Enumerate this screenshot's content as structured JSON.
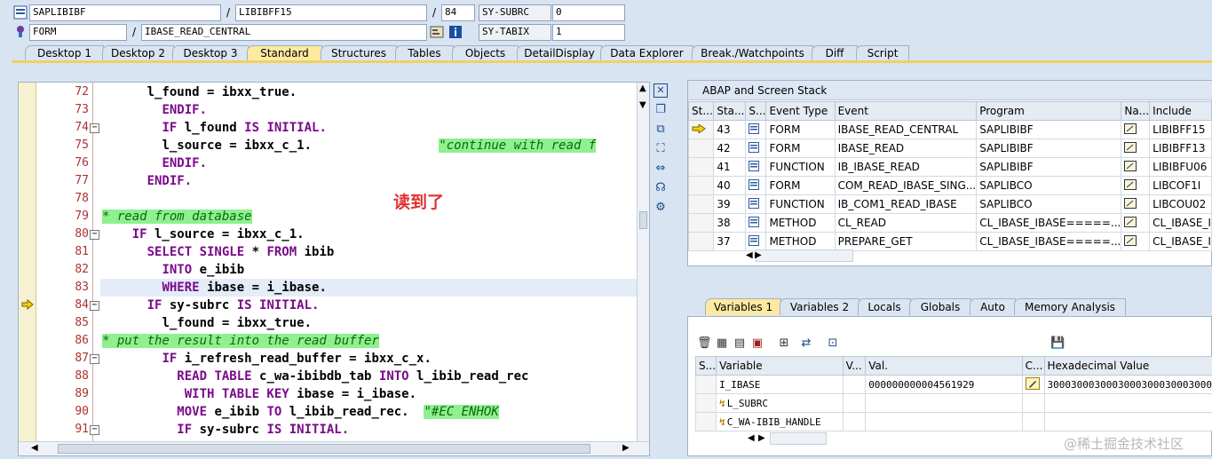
{
  "header": {
    "program": "SAPLIBIBF",
    "include": "LIBIBFF15",
    "line": "84",
    "subrc_label": "SY-SUBRC",
    "subrc_value": "0",
    "event_type": "FORM",
    "event_name": "IBASE_READ_CENTRAL",
    "tabix_label": "SY-TABIX",
    "tabix_value": "1",
    "separator": "/"
  },
  "tabs": [
    "Desktop 1",
    "Desktop 2",
    "Desktop 3",
    "Standard",
    "Structures",
    "Tables",
    "Objects",
    "DetailDisplay",
    "Data Explorer",
    "Break./Watchpoints",
    "Diff",
    "Script"
  ],
  "active_tab": "Standard",
  "editor": {
    "lines": [
      {
        "n": "72",
        "fold": "",
        "marker": ""
      },
      {
        "n": "73",
        "fold": "",
        "marker": ""
      },
      {
        "n": "74",
        "fold": "-",
        "marker": ""
      },
      {
        "n": "75",
        "fold": "",
        "marker": ""
      },
      {
        "n": "76",
        "fold": "",
        "marker": ""
      },
      {
        "n": "77",
        "fold": "",
        "marker": ""
      },
      {
        "n": "78",
        "fold": "",
        "marker": ""
      },
      {
        "n": "79",
        "fold": "",
        "marker": ""
      },
      {
        "n": "80",
        "fold": "-",
        "marker": ""
      },
      {
        "n": "81",
        "fold": "",
        "marker": ""
      },
      {
        "n": "82",
        "fold": "",
        "marker": ""
      },
      {
        "n": "83",
        "fold": "",
        "marker": ""
      },
      {
        "n": "84",
        "fold": "-",
        "marker": "arrow"
      },
      {
        "n": "85",
        "fold": "",
        "marker": ""
      },
      {
        "n": "86",
        "fold": "",
        "marker": ""
      },
      {
        "n": "87",
        "fold": "-",
        "marker": ""
      },
      {
        "n": "88",
        "fold": "",
        "marker": ""
      },
      {
        "n": "89",
        "fold": "",
        "marker": ""
      },
      {
        "n": "90",
        "fold": "",
        "marker": ""
      },
      {
        "n": "91",
        "fold": "-",
        "marker": ""
      }
    ],
    "code": {
      "l72": "      l_found = ibxx_true.",
      "l73_kw": "ENDIF.",
      "l74_kw1": "IF",
      "l74_mid": " l_found ",
      "l74_kw2": "IS INITIAL.",
      "l75": "l_source = ibxx_c_1.",
      "l75_comment": "\"continue with read f",
      "l76_kw": "ENDIF.",
      "l77_kw": "ENDIF.",
      "l79_comment": "* read from database",
      "l80_kw": "IF",
      "l80_rest": " l_source = ibxx_c_1.",
      "l81_kw1": "SELECT SINGLE",
      "l81_mid": " * ",
      "l81_kw2": "FROM",
      "l81_rest": " ibib",
      "l82_kw": "INTO",
      "l82_rest": " e_ibib",
      "l83_kw": "WHERE",
      "l83_rest": " ibase = i_ibase.",
      "l84_kw1": "IF",
      "l84_mid": " sy-subrc ",
      "l84_kw2": "IS INITIAL.",
      "l85": "l_found = ibxx_true.",
      "l86_comment": "* put the result into the read buffer",
      "l87_kw": "IF",
      "l87_rest": " i_refresh_read_buffer = ibxx_c_x.",
      "l88_kw1": "READ TABLE",
      "l88_mid": " c_wa-ibibdb_tab ",
      "l88_kw2": "INTO",
      "l88_rest": " l_ibib_read_rec",
      "l89_kw1": "WITH TABLE KEY",
      "l89_rest": " ibase = i_ibase.",
      "l90_kw1": "MOVE",
      "l90_mid": " e_ibib ",
      "l90_kw2": "TO",
      "l90_rest": " l_ibib_read_rec.",
      "l90_comment": "\"#EC ENHOK",
      "l91_kw1": "IF",
      "l91_mid": " sy-subrc ",
      "l91_kw2": "IS INITIAL."
    }
  },
  "annotation": "读到了",
  "stack": {
    "title": "ABAP and Screen Stack",
    "columns": [
      "St...",
      "Sta...",
      "S...",
      "Event Type",
      "Event",
      "Program",
      "Na...",
      "Include"
    ],
    "rows": [
      {
        "level": "43",
        "type": "FORM",
        "event": "IBASE_READ_CENTRAL",
        "program": "SAPLIBIBF",
        "include": "LIBIBFF15",
        "current": true
      },
      {
        "level": "42",
        "type": "FORM",
        "event": "IBASE_READ",
        "program": "SAPLIBIBF",
        "include": "LIBIBFF13",
        "current": false
      },
      {
        "level": "41",
        "type": "FUNCTION",
        "event": "IB_IBASE_READ",
        "program": "SAPLIBIBF",
        "include": "LIBIBFU06",
        "current": false
      },
      {
        "level": "40",
        "type": "FORM",
        "event": "COM_READ_IBASE_SING...",
        "program": "SAPLIBCO",
        "include": "LIBCOF1I",
        "current": false
      },
      {
        "level": "39",
        "type": "FUNCTION",
        "event": "IB_COM1_READ_IBASE",
        "program": "SAPLIBCO",
        "include": "LIBCOU02",
        "current": false
      },
      {
        "level": "38",
        "type": "METHOD",
        "event": "CL_READ",
        "program": "CL_IBASE_IBASE=====...",
        "include": "CL_IBASE_I",
        "current": false
      },
      {
        "level": "37",
        "type": "METHOD",
        "event": "PREPARE_GET",
        "program": "CL_IBASE_IBASE=====...",
        "include": "CL_IBASE_I",
        "current": false
      }
    ]
  },
  "var_tabs": [
    "Variables 1",
    "Variables 2",
    "Locals",
    "Globals",
    "Auto",
    "Memory Analysis"
  ],
  "active_var_tab": "Variables 1",
  "variables": {
    "columns": [
      "S...",
      "Variable",
      "V...",
      "Val.",
      "C...",
      "Hexadecimal Value"
    ],
    "rows": [
      {
        "name": "I_IBASE",
        "value": "000000000004561929",
        "hex": "3000300030003000300030003000",
        "icon": ""
      },
      {
        "name": "L_SUBRC",
        "value": "",
        "hex": "",
        "icon": "struct"
      },
      {
        "name": "C_WA-IBIB_HANDLE",
        "value": "",
        "hex": "",
        "icon": "struct"
      }
    ]
  },
  "watermark": "@稀土掘金技术社区"
}
